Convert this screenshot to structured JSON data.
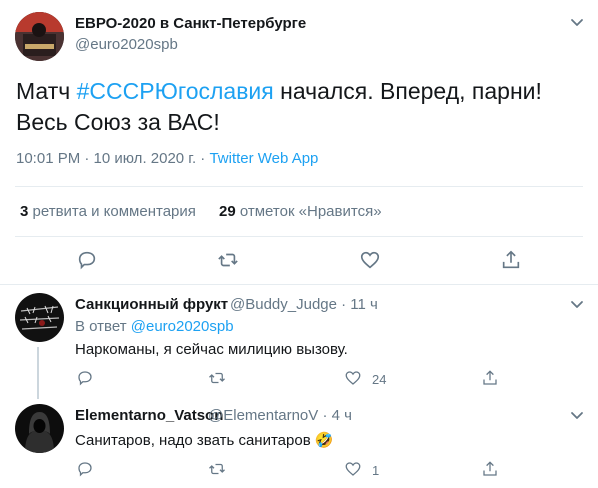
{
  "tweet": {
    "author_name": "ЕВРО-2020 в Санкт-Петербурге",
    "author_handle": "@euro2020spb",
    "text_prefix": "Матч ",
    "hashtag": "#СССРЮгославия",
    "text_suffix": " начался. Вперед, парни! Весь Союз за ВАС!",
    "time": "10:01 PM · 10 июл. 2020 г. · ",
    "client": "Twitter Web App",
    "retweets_count": "3",
    "retweets_label": " ретвита и комментария",
    "likes_count": "29",
    "likes_label": " отметок «Нравится»",
    "icons": [
      "reply-icon",
      "retweet-icon",
      "like-icon",
      "share-icon",
      "chevron-down-icon"
    ]
  },
  "replies": [
    {
      "name": "Санкционный фрукт",
      "handle": "@Buddy_Judge · 11 ч",
      "reply_prefix": "В ответ ",
      "reply_to": "@euro2020spb",
      "text": "Наркоманы, я сейчас милицию вызову.",
      "likes": "24"
    },
    {
      "name": "Elementarno_Vatson",
      "handle": "@ElementarnoV · 4 ч",
      "text": "Санитаров, надо звать санитаров 🤣",
      "likes": "1"
    }
  ],
  "colors": {
    "accent": "#1da1f2",
    "secondary": "#657786",
    "primary": "#14171a",
    "divider": "#e6ecf0"
  }
}
